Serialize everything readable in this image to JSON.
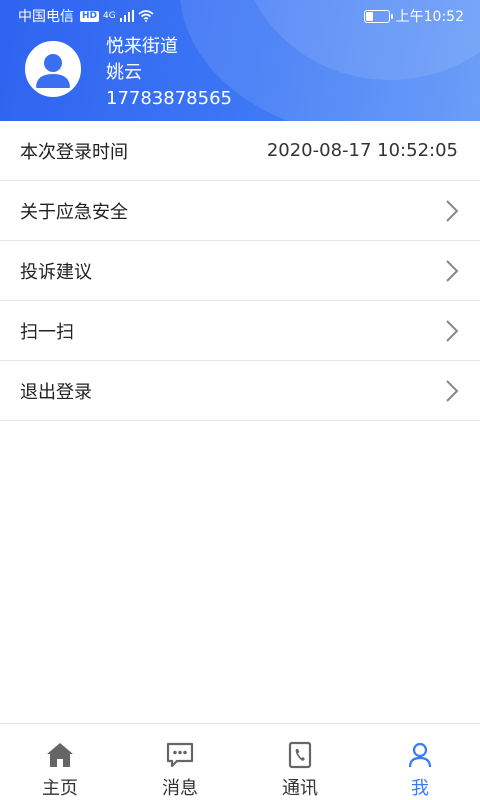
{
  "statusbar": {
    "carrier": "中国电信",
    "hd": "HD",
    "network": "4G",
    "time": "上午10:52"
  },
  "profile": {
    "org": "悦来街道",
    "name": "姚云",
    "phone": "17783878565"
  },
  "list": {
    "login_time_label": "本次登录时间",
    "login_time_value": "2020-08-17 10:52:05",
    "about_label": "关于应急安全",
    "feedback_label": "投诉建议",
    "scan_label": "扫一扫",
    "logout_label": "退出登录"
  },
  "tabs": [
    {
      "label": "主页",
      "icon": "home-icon"
    },
    {
      "label": "消息",
      "icon": "message-icon"
    },
    {
      "label": "通讯",
      "icon": "phone-book-icon"
    },
    {
      "label": "我",
      "icon": "user-icon"
    }
  ],
  "colors": {
    "header_start": "#2f63f0",
    "header_end": "#5a93f7",
    "accent": "#3a7af5",
    "icon_gray": "#666666"
  }
}
